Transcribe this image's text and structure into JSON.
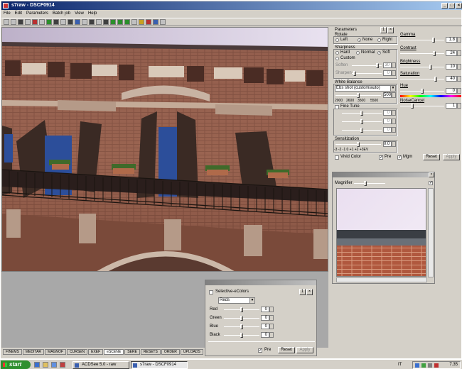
{
  "window": {
    "title": "s7raw - DSCF0914",
    "controls": [
      "_",
      "□",
      "×"
    ]
  },
  "menu": [
    "File",
    "Edit",
    "Parameters",
    "Batch job",
    "View",
    "Help"
  ],
  "toolbar": {
    "button_count": 27
  },
  "bottom_tabs": [
    "FINEMS",
    "MEDITAR",
    "MAGNOF",
    "CURSEN",
    "EXEF",
    "eSCENE",
    "SERE",
    "RESETS",
    "ORDER",
    "UPLOADS"
  ],
  "params": {
    "title": "Parameters",
    "rotate": {
      "label": "Rotate",
      "options": [
        "Left",
        "None",
        "Right"
      ],
      "selected": "None"
    },
    "sharpness": {
      "label": "Sharpness",
      "options": [
        "Hard",
        "Normal",
        "Soft",
        "Custom"
      ],
      "selected": "Soft",
      "soften_label": "Soften",
      "soften_value": "30",
      "sharpen_label": "Sharpen",
      "sharpen_value": "0"
    },
    "white_balance": {
      "label": "White Balance",
      "selected": "Ebs shot (custom/auto)",
      "value": "500",
      "ticks": [
        "2000",
        "2600",
        "3500",
        "5500"
      ]
    },
    "fine_tune": {
      "label": "Fine Tune",
      "values": [
        "0",
        "0",
        "0"
      ]
    },
    "sensitization": {
      "label": "Sensitization",
      "value": "0.0",
      "ticks": "-3  -2  -1  0  +1  +2  +3EV"
    },
    "vivid_color": "Vivid Color",
    "pre_label": "Pre",
    "pre_checked": true,
    "mgm_label": "Mgm",
    "mgm_checked": true,
    "reset": "Reset",
    "apply": "Apply",
    "gamma": {
      "label": "Gamma",
      "value": "1.8",
      "level": 0.78
    },
    "contrast": {
      "label": "Contrast",
      "value": "24",
      "level": 0.8
    },
    "brightness": {
      "label": "Brightness",
      "value": "10",
      "level": 0.7
    },
    "saturation": {
      "label": "Saturation",
      "value": "40",
      "level": 0.82
    },
    "hue": {
      "label": "Hue",
      "value": "0",
      "level": 0.5
    },
    "noise_cancel": {
      "label": "NoiseCancel",
      "value": "1",
      "level": 0.25
    }
  },
  "magnifier": {
    "label": "Magnifier"
  },
  "selective_colors": {
    "title": "Selective-eColors",
    "selected": "Reds",
    "rows": [
      {
        "label": "Red",
        "value": "0"
      },
      {
        "label": "Green",
        "value": "0"
      },
      {
        "label": "Blue",
        "value": "0"
      },
      {
        "label": "Black",
        "value": "0"
      }
    ],
    "pre_label": "Pre",
    "reset": "Reset",
    "apply": "Apply"
  },
  "taskbar": {
    "start": "start",
    "tasks": [
      {
        "label": "ACDSee 5.0 - raw",
        "active": false
      },
      {
        "label": "s7raw - DSCF0914",
        "active": true
      }
    ],
    "tray_lang": "IT",
    "clock": "7.35"
  }
}
